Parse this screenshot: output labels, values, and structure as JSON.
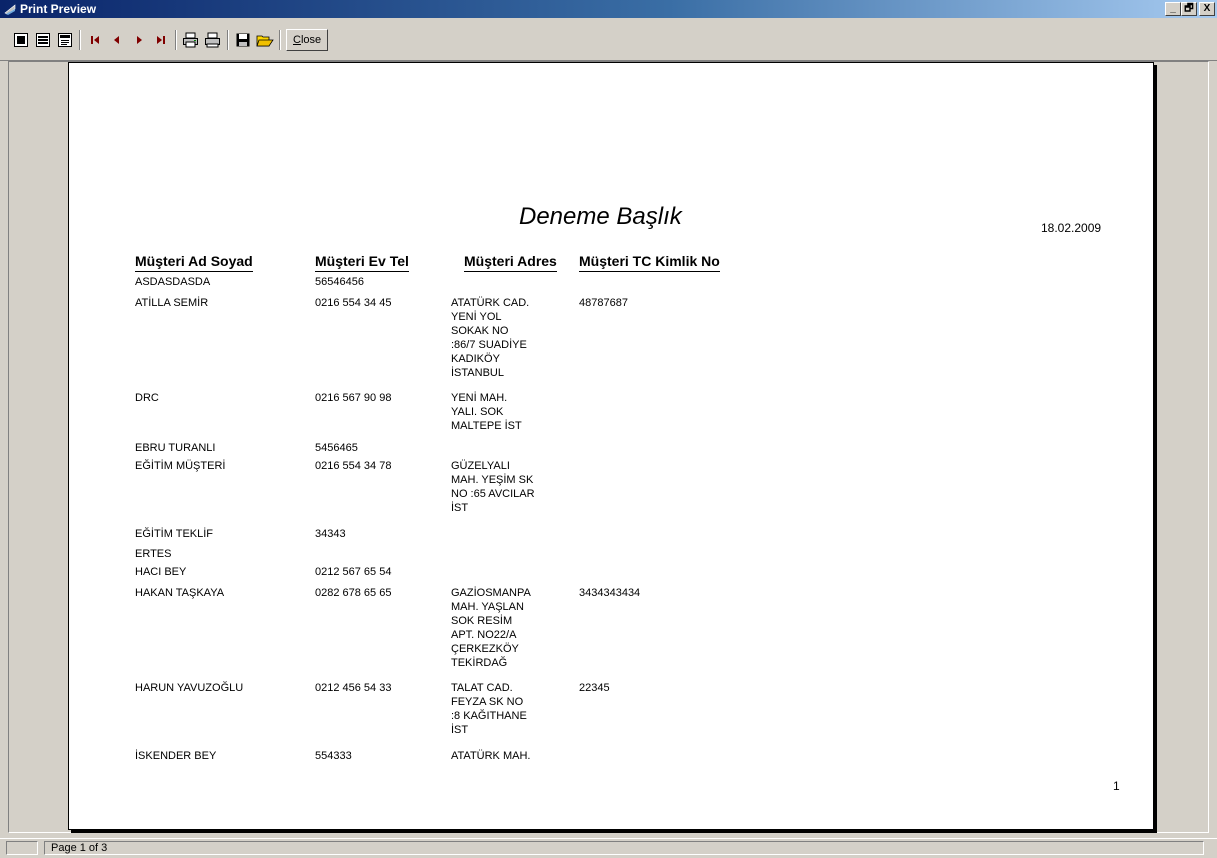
{
  "window": {
    "title": "Print Preview",
    "controls": [
      "_",
      "🗗",
      "X"
    ]
  },
  "toolbar": {
    "buttons": [
      {
        "icon": "whole-page-icon"
      },
      {
        "icon": "page-width-icon"
      },
      {
        "icon": "zoom-100-icon"
      },
      {
        "icon": "first-page-icon"
      },
      {
        "icon": "previous-page-icon"
      },
      {
        "icon": "next-page-icon"
      },
      {
        "icon": "last-page-icon"
      },
      {
        "icon": "print-setup-icon"
      },
      {
        "icon": "print-icon"
      },
      {
        "icon": "save-icon"
      },
      {
        "icon": "open-icon"
      }
    ],
    "close_label_underlined": "C",
    "close_label_rest": "lose"
  },
  "report": {
    "title": "Deneme Başlık",
    "date": "18.02.2009",
    "columns": [
      "Müşteri Ad Soyad",
      "Müşteri Ev Tel",
      "Müşteri Adres",
      "Müşteri TC Kimlik No"
    ],
    "rows": [
      {
        "name": "ASDASDASDA",
        "tel": "56546456",
        "adres": "",
        "tc": ""
      },
      {
        "name": "ATİLLA SEMİR",
        "tel": "0216 554 34 45",
        "adres": "ATATÜRK CAD.\nYENİ YOL\nSOKAK NO\n:86/7 SUADİYE\nKADIKÖY\nİSTANBUL",
        "tc": "48787687"
      },
      {
        "name": "DRC",
        "tel": "0216 567 90 98",
        "adres": "YENİ MAH.\nYALI. SOK\nMALTEPE İST",
        "tc": ""
      },
      {
        "name": "EBRU TURANLI",
        "tel": "5456465",
        "adres": "",
        "tc": ""
      },
      {
        "name": "EĞİTİM MÜŞTERİ",
        "tel": "0216 554 34 78",
        "adres": "GÜZELYALI\nMAH. YEŞİM SK\nNO :65 AVCILAR\nİST",
        "tc": ""
      },
      {
        "name": "EĞİTİM TEKLİF",
        "tel": "34343",
        "adres": "",
        "tc": ""
      },
      {
        "name": "ERTES",
        "tel": "",
        "adres": "",
        "tc": ""
      },
      {
        "name": "HACI BEY",
        "tel": "0212 567 65 54",
        "adres": "",
        "tc": ""
      },
      {
        "name": "HAKAN TAŞKAYA",
        "tel": "0282 678 65 65",
        "adres": "GAZİOSMANPA\nMAH. YAŞLAN\nSOK RESİM\nAPT. NO22/A\nÇERKEZKÖY\nTEKİRDAĞ",
        "tc": "3434343434"
      },
      {
        "name": "HARUN YAVUZOĞLU",
        "tel": "0212 456 54 33",
        "adres": "TALAT CAD.\nFEYZA SK NO\n:8 KAĞITHANE\nİST",
        "tc": "22345"
      },
      {
        "name": "İSKENDER BEY",
        "tel": "554333",
        "adres": "ATATÜRK MAH.",
        "tc": ""
      }
    ],
    "page_number": "1"
  },
  "status": {
    "page_text": "Page 1 of 3"
  }
}
